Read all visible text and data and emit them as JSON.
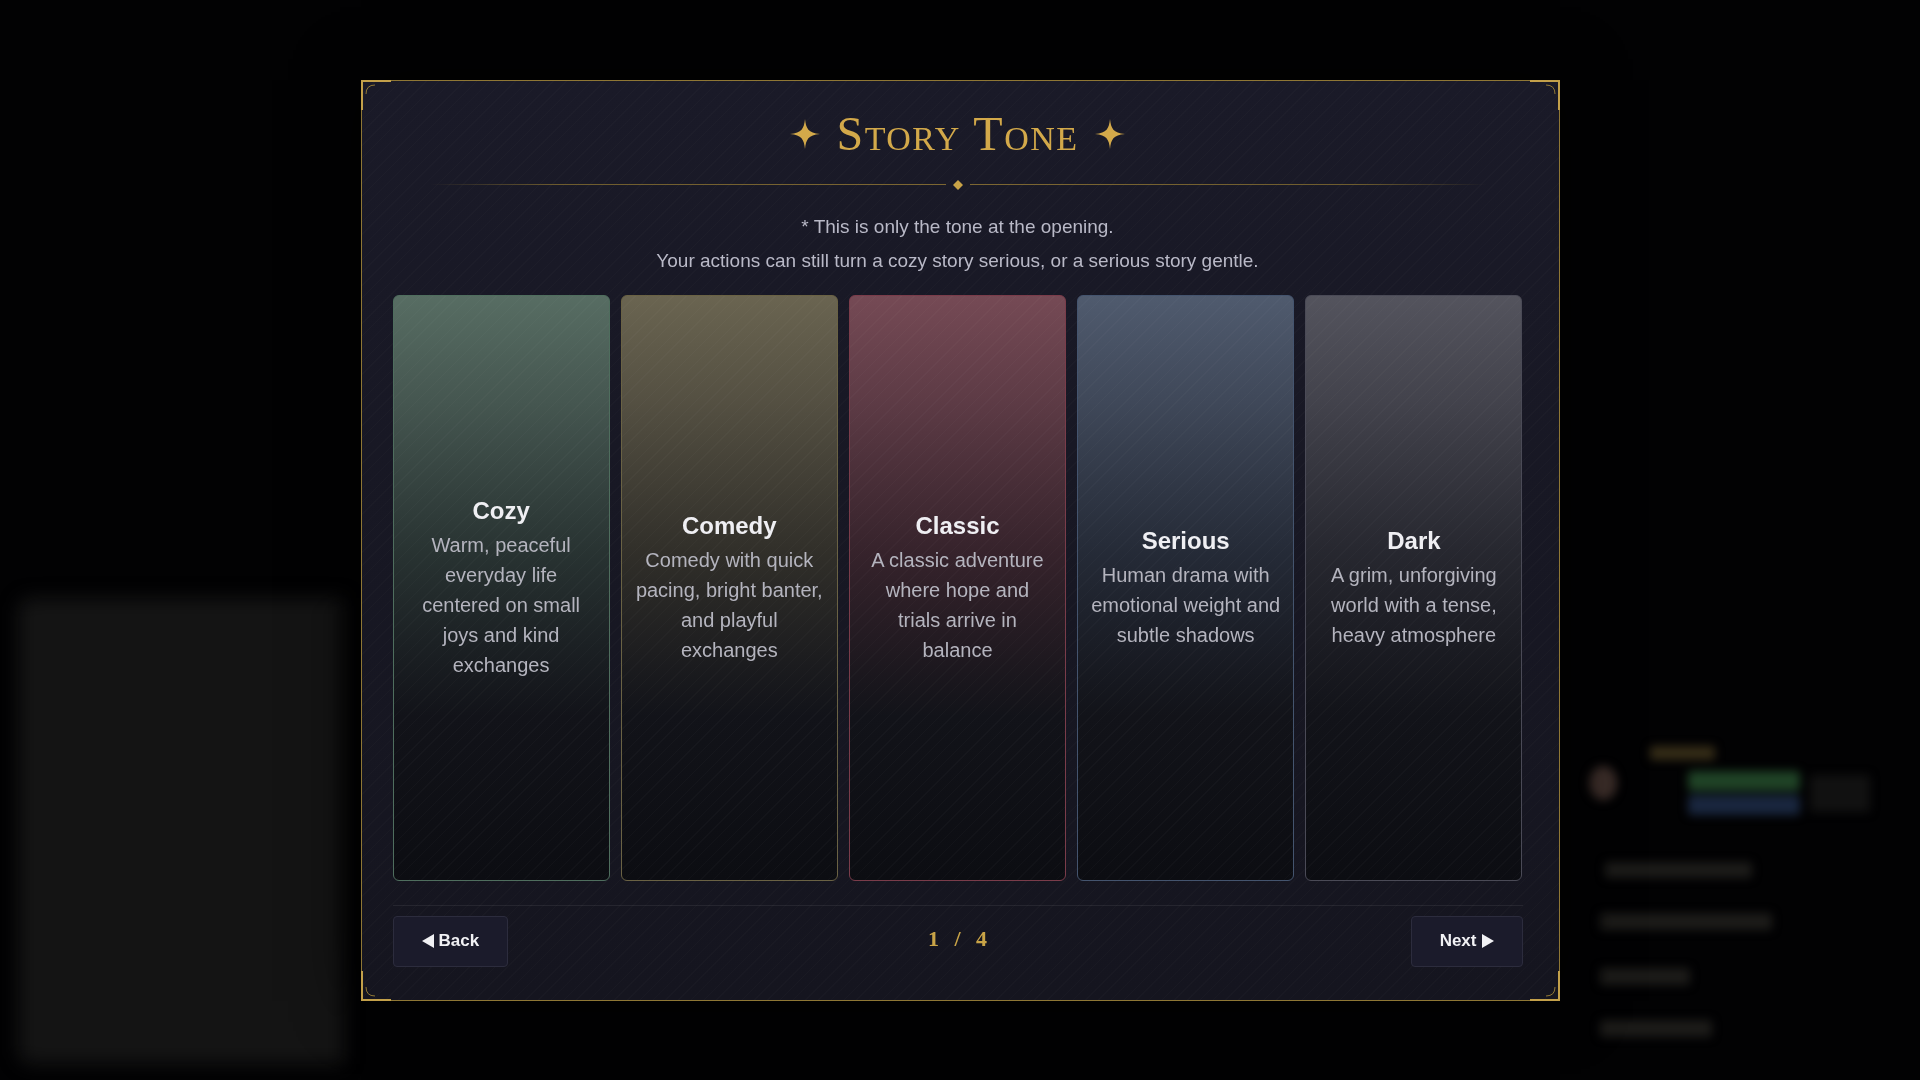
{
  "dialog": {
    "title": "Story Tone",
    "notes": [
      "* This is only the tone at the opening.",
      "Your actions can still turn a cozy story serious, or a serious story gentle."
    ],
    "tones": [
      {
        "name": "Cozy",
        "description": "Warm, peaceful everyday life centered on small joys and kind exchanges",
        "color": "#4f6e5e"
      },
      {
        "name": "Comedy",
        "description": "Comedy with quick pacing, bright banter, and playful exchanges",
        "color": "#6a6244"
      },
      {
        "name": "Classic",
        "description": "A classic adventure where hope and trials arrive in balance",
        "color": "#7a3c4a"
      },
      {
        "name": "Serious",
        "description": "Human drama with emotional weight and subtle shadows",
        "color": "#44546e"
      },
      {
        "name": "Dark",
        "description": "A grim, unforgiving world with a tense, heavy atmosphere",
        "color": "#4a4a56"
      }
    ],
    "back_button": {
      "label": "Back"
    },
    "page_indicator": "1 / 4",
    "next_button": {
      "label": "Next"
    }
  }
}
